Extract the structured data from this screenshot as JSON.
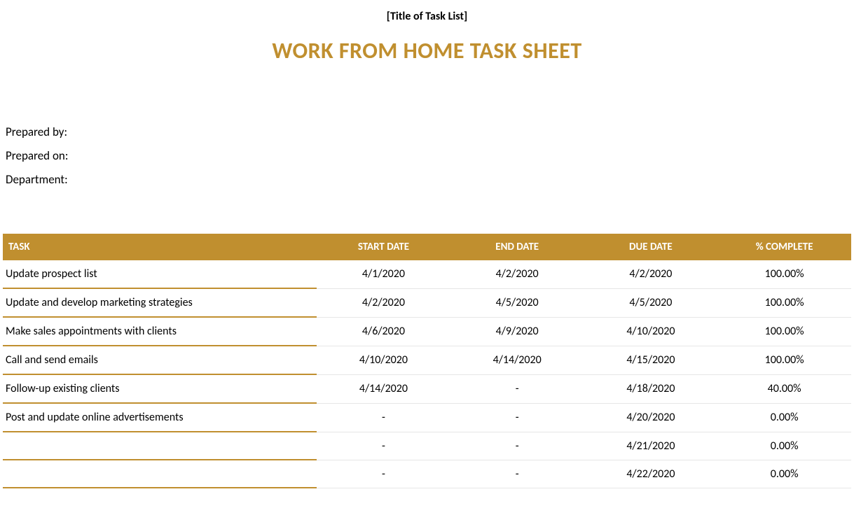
{
  "placeholder_title": "[Title of Task List]",
  "main_title": "WORK FROM HOME TASK SHEET",
  "meta": {
    "prepared_by_label": "Prepared by:",
    "prepared_on_label": "Prepared on:",
    "department_label": "Department:"
  },
  "table": {
    "headers": {
      "task": "TASK",
      "start": "START DATE",
      "end": "END DATE",
      "due": "DUE DATE",
      "complete": "% COMPLETE"
    },
    "rows": [
      {
        "task": "Update prospect list",
        "start": "4/1/2020",
        "end": "4/2/2020",
        "due": "4/2/2020",
        "complete": "100.00%"
      },
      {
        "task": "Update and develop marketing strategies",
        "start": "4/2/2020",
        "end": "4/5/2020",
        "due": "4/5/2020",
        "complete": "100.00%"
      },
      {
        "task": "Make sales appointments with clients",
        "start": "4/6/2020",
        "end": "4/9/2020",
        "due": "4/10/2020",
        "complete": "100.00%"
      },
      {
        "task": "Call and send emails",
        "start": "4/10/2020",
        "end": "4/14/2020",
        "due": "4/15/2020",
        "complete": "100.00%"
      },
      {
        "task": "Follow-up existing clients",
        "start": "4/14/2020",
        "end": "-",
        "due": "4/18/2020",
        "complete": "40.00%"
      },
      {
        "task": "Post and update online advertisements",
        "start": "-",
        "end": "-",
        "due": "4/20/2020",
        "complete": "0.00%"
      },
      {
        "task": "",
        "start": "-",
        "end": "-",
        "due": "4/21/2020",
        "complete": "0.00%"
      },
      {
        "task": "",
        "start": "-",
        "end": "-",
        "due": "4/22/2020",
        "complete": "0.00%"
      }
    ]
  }
}
